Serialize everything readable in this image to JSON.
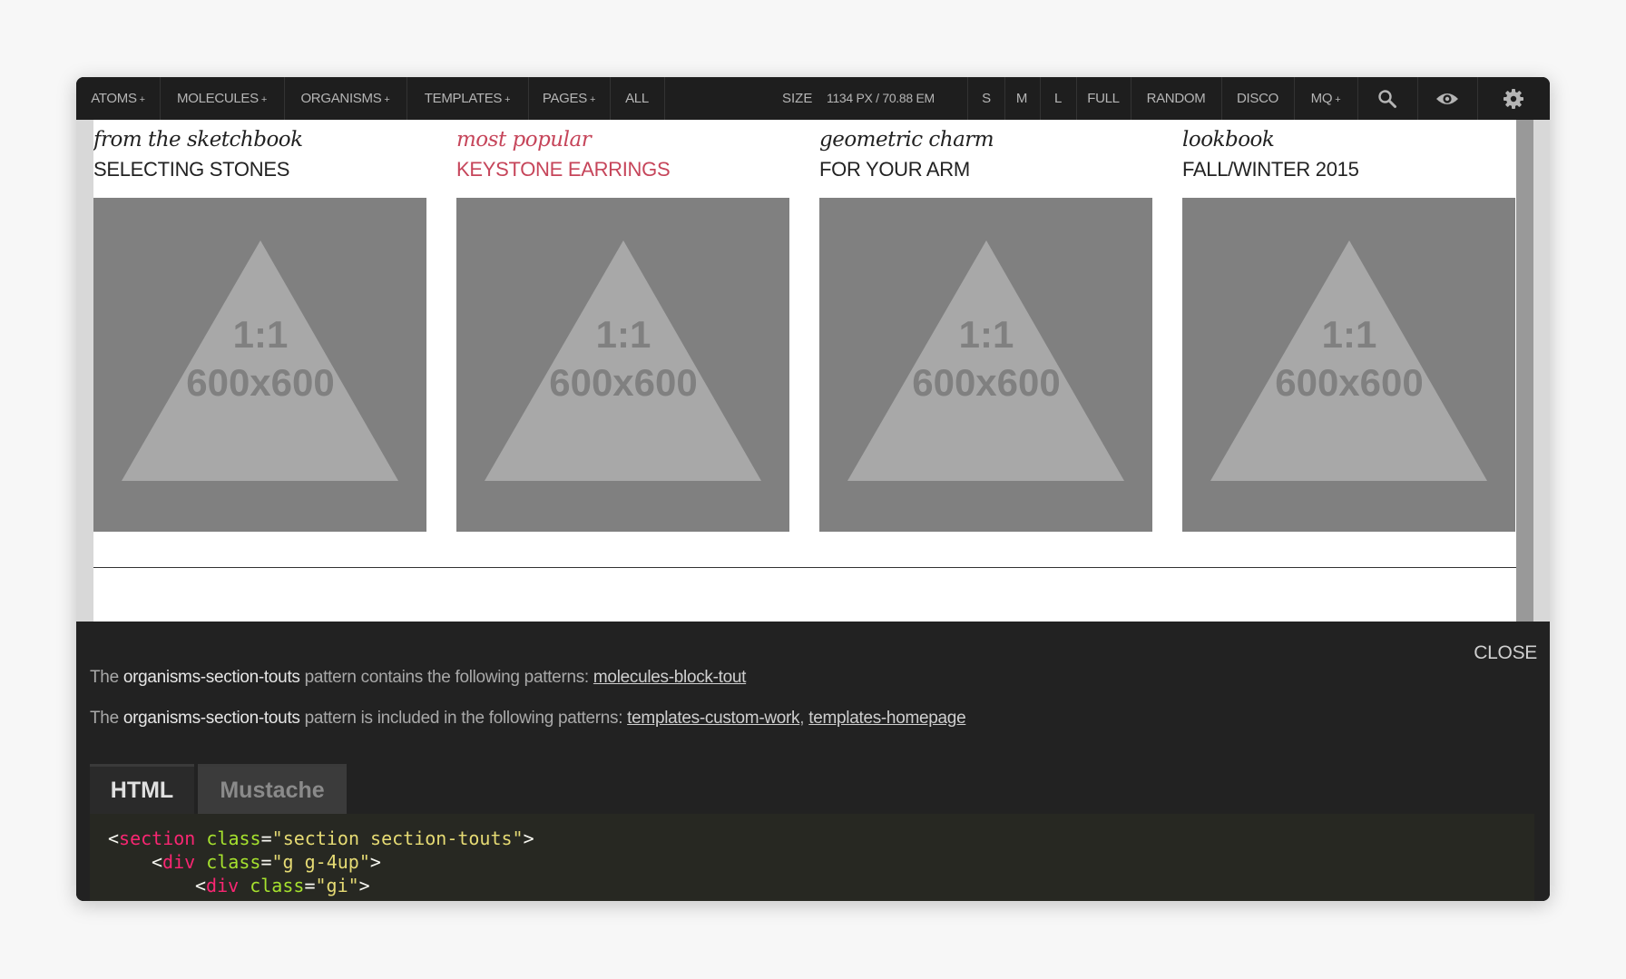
{
  "toolbar": {
    "nav": [
      {
        "label": "ATOMS",
        "has_menu": true
      },
      {
        "label": "MOLECULES",
        "has_menu": true
      },
      {
        "label": "ORGANISMS",
        "has_menu": true
      },
      {
        "label": "TEMPLATES",
        "has_menu": true
      },
      {
        "label": "PAGES",
        "has_menu": true
      },
      {
        "label": "ALL",
        "has_menu": false
      }
    ],
    "size_label": "SIZE",
    "size_value": "1134 PX / 70.88 EM",
    "size_buttons": [
      "S",
      "M",
      "L",
      "FULL",
      "RANDOM",
      "DISCO"
    ],
    "mq_label": "MQ",
    "plus": "+",
    "icons": [
      "search-icon",
      "eye-icon",
      "gear-icon"
    ]
  },
  "touts": [
    {
      "kicker": "from the sketchbook",
      "headline": "SELECTING STONES",
      "placeholder_ratio": "1:1",
      "placeholder_size": "600x600",
      "highlighted": false
    },
    {
      "kicker": "most popular",
      "headline": "KEYSTONE EARRINGS",
      "placeholder_ratio": "1:1",
      "placeholder_size": "600x600",
      "highlighted": true
    },
    {
      "kicker": "geometric charm",
      "headline": "FOR YOUR ARM",
      "placeholder_ratio": "1:1",
      "placeholder_size": "600x600",
      "highlighted": false
    },
    {
      "kicker": "lookbook",
      "headline": "FALL/WINTER 2015",
      "placeholder_ratio": "1:1",
      "placeholder_size": "600x600",
      "highlighted": false
    }
  ],
  "panel": {
    "close_label": "CLOSE",
    "contains": {
      "prefix": "The ",
      "pattern": "organisms-section-touts",
      "middle": " pattern contains the following patterns: ",
      "links": [
        "molecules-block-tout"
      ]
    },
    "included": {
      "prefix": "The ",
      "pattern": "organisms-section-touts",
      "middle": " pattern is included in the following patterns: ",
      "links": [
        "templates-custom-work",
        "templates-homepage"
      ],
      "separator": ", "
    },
    "tabs": [
      {
        "label": "HTML",
        "active": true
      },
      {
        "label": "Mustache",
        "active": false
      }
    ],
    "code": {
      "line1": {
        "lt": "<",
        "tag": "section",
        "attr": "class",
        "eq": "=",
        "value": "\"section section-touts\"",
        "gt": ">"
      },
      "line2": {
        "lt": "<",
        "tag": "div",
        "attr": "class",
        "eq": "=",
        "value": "\"g g-4up\"",
        "gt": ">"
      },
      "line3": {
        "lt": "<",
        "tag": "div",
        "attr": "class",
        "eq": "=",
        "value": "\"gi\"",
        "gt": ">"
      }
    }
  },
  "colors": {
    "accent_pink": "#c6455a",
    "toolbar_bg": "#1e1e1e",
    "panel_bg": "#222222",
    "placeholder_bg": "#808080",
    "placeholder_shape": "#a8a8a8",
    "code_tag": "#f92672",
    "code_attr": "#a6e22e",
    "code_string": "#e6db74"
  }
}
